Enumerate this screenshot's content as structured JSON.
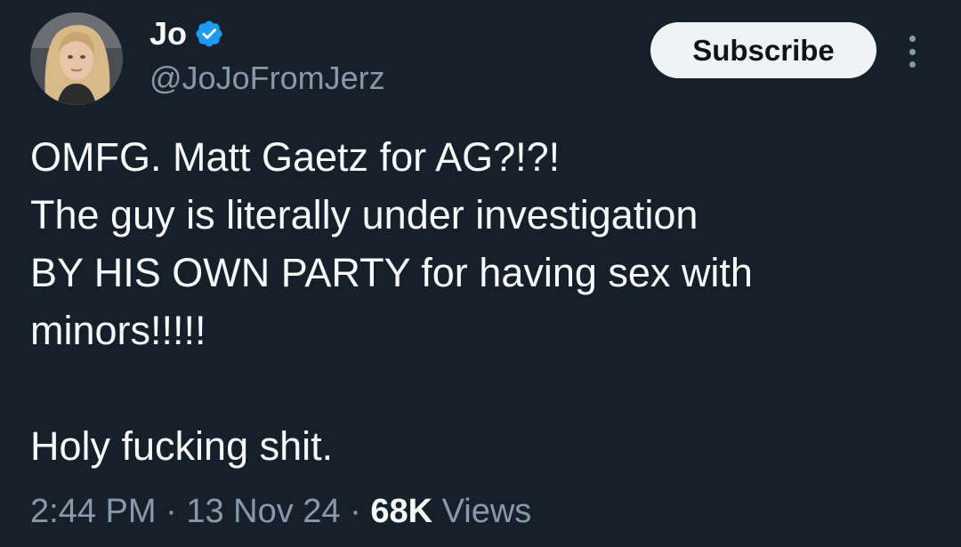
{
  "author": {
    "display_name": "Jo",
    "handle": "@JoJoFromJerz",
    "verified_icon": "verified-badge-icon"
  },
  "actions": {
    "subscribe_label": "Subscribe",
    "more_icon": "more-vertical-icon"
  },
  "tweet": {
    "lines": [
      "OMFG. Matt Gaetz for AG?!?!",
      "The guy is literally under investigation",
      "BY HIS OWN PARTY for having sex with",
      "minors!!!!!"
    ],
    "closing_line": "Holy fucking shit."
  },
  "meta": {
    "time": "2:44 PM",
    "separator": "·",
    "date": "13 Nov 24",
    "views_count": "68K",
    "views_label": "Views"
  },
  "colors": {
    "background": "#15202b",
    "primary_text": "#f7f9f9",
    "secondary_text": "#8b98a5",
    "verified_blue": "#1d9bf0",
    "button_bg": "#eff3f4"
  }
}
